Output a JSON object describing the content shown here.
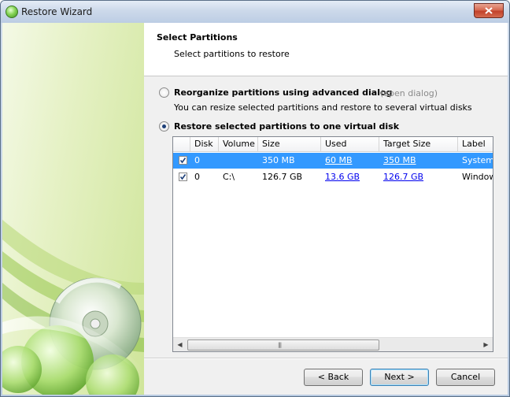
{
  "window": {
    "title": "Restore Wizard"
  },
  "header": {
    "title": "Select Partitions",
    "subtitle": "Select partitions to restore"
  },
  "options": {
    "advanced": {
      "label": "Reorganize partitions using advanced dialog",
      "link": "(open dialog)",
      "description": "You can resize selected partitions and restore to several virtual disks",
      "selected": false
    },
    "single": {
      "label": "Restore selected partitions to one virtual disk",
      "selected": true
    }
  },
  "table": {
    "columns": [
      "Disk",
      "Volume",
      "Size",
      "Used",
      "Target Size",
      "Label"
    ],
    "rows": [
      {
        "checked": true,
        "disk": "0",
        "volume": "",
        "size": "350 MB",
        "used": "60 MB",
        "target": "350 MB",
        "label": "System",
        "selected": true
      },
      {
        "checked": true,
        "disk": "0",
        "volume": "C:\\",
        "size": "126.7 GB",
        "used": "13.6 GB",
        "target": "126.7 GB",
        "label": "Window",
        "selected": false
      }
    ]
  },
  "buttons": {
    "back": "< Back",
    "next": "Next >",
    "cancel": "Cancel"
  },
  "colors": {
    "selection": "#3399ff",
    "link": "#0000ee",
    "side_panel": "#cfe59a"
  },
  "icons": {
    "app": "disc-app-icon",
    "close": "close-icon"
  }
}
